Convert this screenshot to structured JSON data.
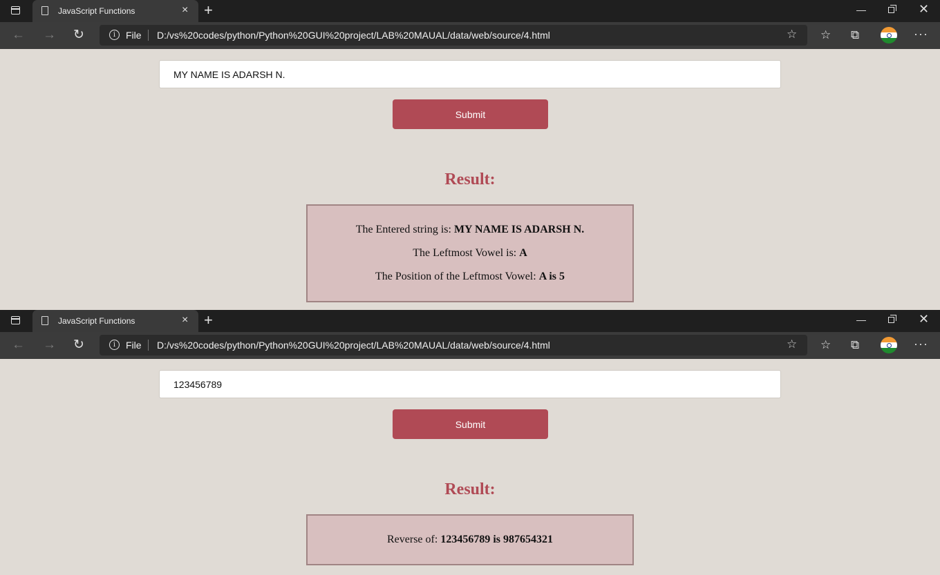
{
  "windows": [
    {
      "tab_title": "JavaScript Functions",
      "file_label": "File",
      "url": "D:/vs%20codes/python/Python%20GUI%20project/LAB%20MAUAL/data/web/source/4.html",
      "input_value": "MY NAME IS ADARSH N.",
      "submit_label": "Submit",
      "result_heading": "Result:",
      "lines": [
        {
          "text": "The Entered string is: ",
          "bold": "MY NAME IS ADARSH N."
        },
        {
          "text": "The Leftmost Vowel is: ",
          "bold": "A"
        },
        {
          "text": "The Position of the Leftmost Vowel: ",
          "bold": "A is 5"
        }
      ]
    },
    {
      "tab_title": "JavaScript Functions",
      "file_label": "File",
      "url": "D:/vs%20codes/python/Python%20GUI%20project/LAB%20MAUAL/data/web/source/4.html",
      "input_value": "123456789",
      "submit_label": "Submit",
      "result_heading": "Result:",
      "lines": [
        {
          "text": "Reverse of: ",
          "bold": "123456789 is 987654321"
        }
      ]
    }
  ],
  "icons": {
    "close_tab": "×",
    "new_tab": "+",
    "back": "←",
    "forward": "→",
    "reload": "↻",
    "favorite_add": "☆",
    "favorites": "☆",
    "collections": "⧉",
    "more": "···",
    "minimize": "—",
    "close_window": "✕"
  }
}
